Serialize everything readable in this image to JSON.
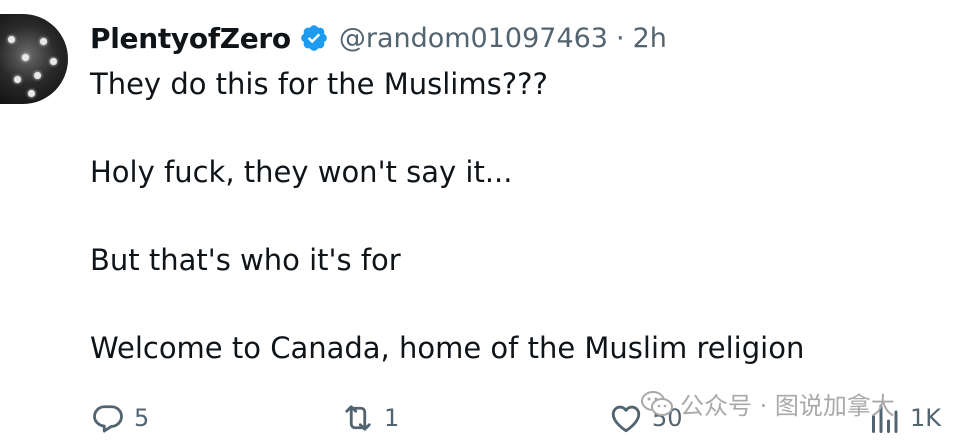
{
  "author": {
    "display_name": "PlentyofZero",
    "handle": "@random01097463",
    "separator": "·",
    "time": "2h",
    "verified_icon": "verified-badge-icon",
    "avatar_icon": "avatar-image"
  },
  "tweet": {
    "paragraphs": [
      "They do this for the Muslims???",
      "Holy fuck, they won't say it...",
      "But that's who it's for",
      "Welcome to Canada, home of the Muslim religion"
    ]
  },
  "actions": {
    "reply": {
      "icon": "reply-icon",
      "count": "5"
    },
    "retweet": {
      "icon": "retweet-icon",
      "count": "1"
    },
    "like": {
      "icon": "like-icon",
      "count": "50"
    },
    "views": {
      "icon": "views-icon",
      "count": "1K"
    }
  },
  "watermark": {
    "text": "公众号 · 图说加拿大",
    "icon": "wechat-icon"
  },
  "colors": {
    "text": "#0f1419",
    "muted": "#536471",
    "verified": "#1d9bf0",
    "background": "#ffffff"
  }
}
